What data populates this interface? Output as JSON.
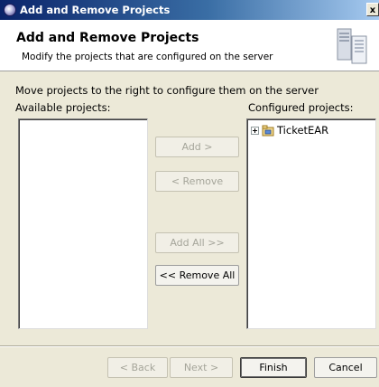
{
  "window": {
    "title": "Add and Remove Projects"
  },
  "banner": {
    "title": "Add and Remove Projects",
    "description": "Modify the projects that are configured on the server"
  },
  "instruction": "Move projects to the right to configure them on the server",
  "available": {
    "label": "Available projects:",
    "items": []
  },
  "configured": {
    "label": "Configured projects:",
    "items": [
      {
        "label": "TicketEAR",
        "expanded": false
      }
    ]
  },
  "buttons": {
    "add": "Add >",
    "remove": "< Remove",
    "add_all": "Add All >>",
    "remove_all": "<< Remove All",
    "back": "< Back",
    "next": "Next >",
    "finish": "Finish",
    "cancel": "Cancel"
  },
  "close_glyph": "x"
}
